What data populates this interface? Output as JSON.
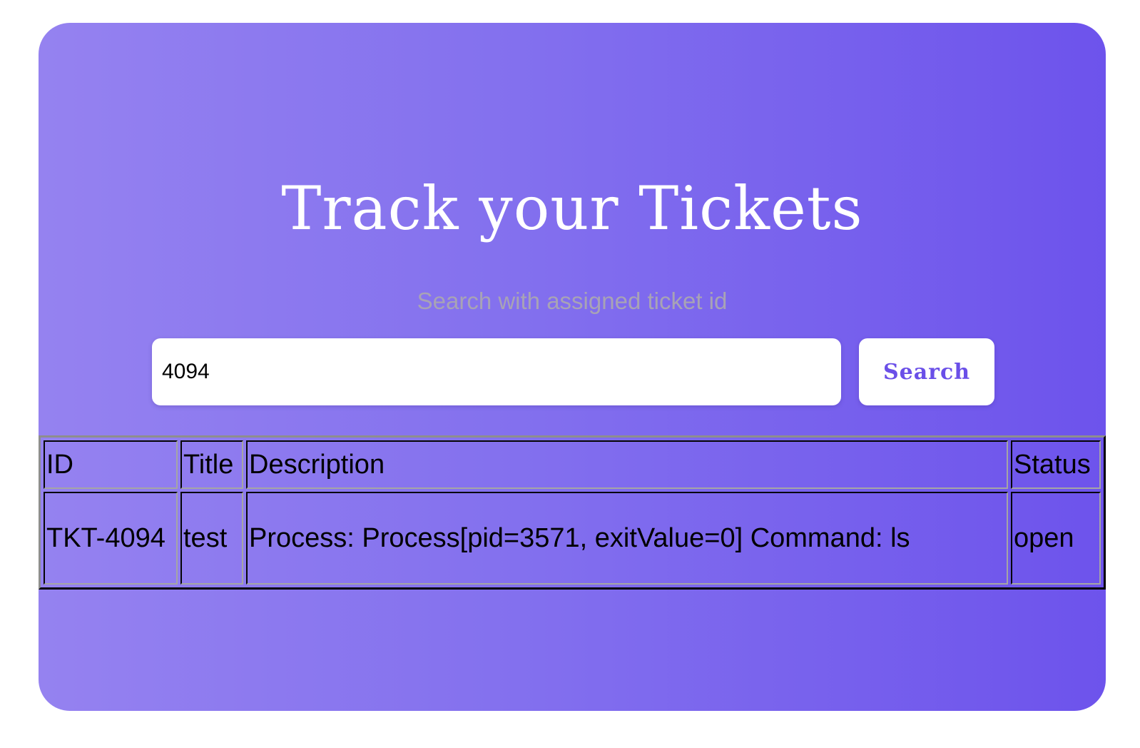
{
  "header": {
    "title": "Track your Tickets",
    "subtitle": "Search with assigned ticket id"
  },
  "search": {
    "value": "4094",
    "button_label": "Search"
  },
  "table": {
    "columns": [
      "ID",
      "Title",
      "Description",
      "Status"
    ],
    "rows": [
      {
        "id": "TKT-4094",
        "title": "test",
        "description": "Process: Process[pid=3571, exitValue=0] Command: ls",
        "status": "open"
      }
    ]
  },
  "colors": {
    "gradient_start": "#9582f0",
    "gradient_end": "#6d53ec",
    "button_text": "#6a4fe8",
    "subtitle_text": "#a8a3b5"
  }
}
